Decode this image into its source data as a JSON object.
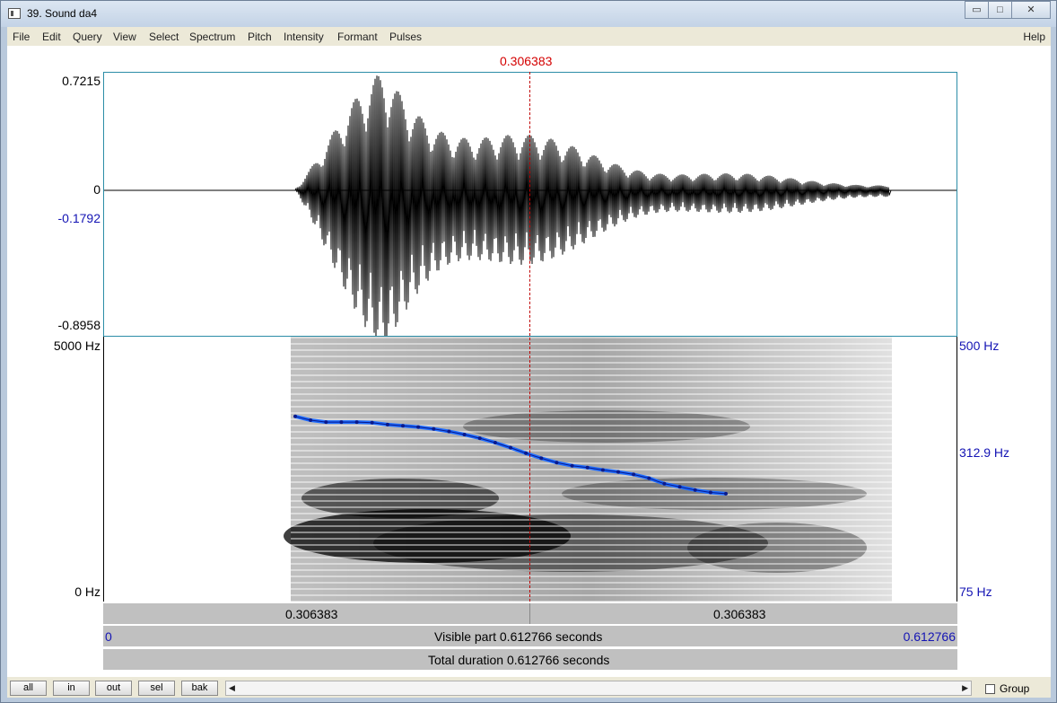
{
  "window": {
    "title": "39. Sound da4",
    "buttons": {
      "minimize": "▭",
      "maximize": "□",
      "close": "✕"
    }
  },
  "menu": [
    "File",
    "Edit",
    "Query",
    "View",
    "Select",
    "Spectrum",
    "Pitch",
    "Intensity",
    "Formant",
    "Pulses"
  ],
  "help": "Help",
  "cursor": {
    "time": "0.306383"
  },
  "waveform": {
    "ymax": "0.7215",
    "zero": "0",
    "cursor_value": "-0.1792",
    "ymin": "-0.8958"
  },
  "spectrogram": {
    "ymax": "5000 Hz",
    "ymin": "0 Hz"
  },
  "pitch": {
    "ymax": "500 Hz",
    "mid": "312.9 Hz",
    "ymin": "75 Hz",
    "contour_hz": [
      372,
      366,
      363,
      363,
      363,
      362,
      359,
      357,
      355,
      352,
      348,
      343,
      337,
      330,
      322,
      313,
      305,
      298,
      293,
      290,
      286,
      283,
      279,
      273,
      264,
      259,
      254,
      250,
      248
    ]
  },
  "bars": {
    "left_time": "0.306383",
    "right_time": "0.306383",
    "visible_start": "0",
    "visible_label": "Visible part 0.612766 seconds",
    "visible_end": "0.612766",
    "total_label": "Total duration 0.612766 seconds"
  },
  "bottom": {
    "buttons": [
      "all",
      "in",
      "out",
      "sel",
      "bak"
    ],
    "group_label": "Group",
    "scroll_left": "◀",
    "scroll_right": "▶"
  },
  "colors": {
    "cursor": "#d40000",
    "axis_blue": "#1414b4",
    "pitch_line": "#1e6cff",
    "pitch_point": "#0a1a8c"
  }
}
